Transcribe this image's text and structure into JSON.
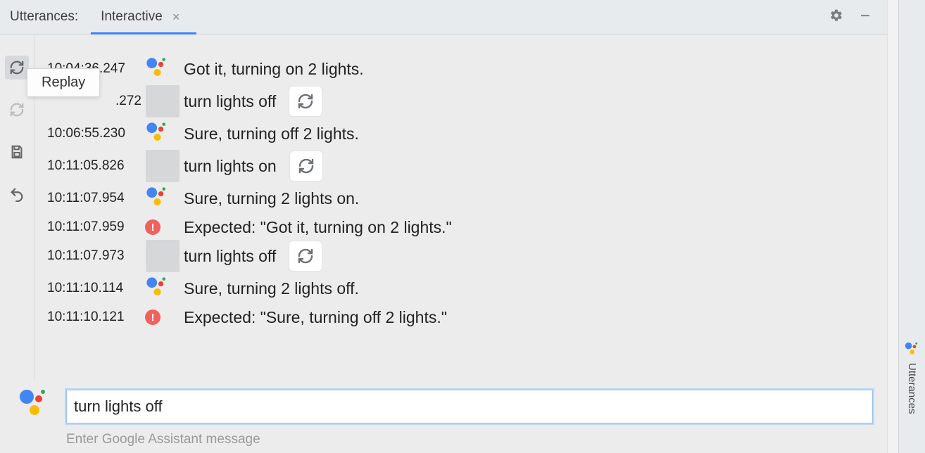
{
  "header": {
    "title_label": "Utterances:",
    "active_tab": "Interactive"
  },
  "tooltip": {
    "replay": "Replay"
  },
  "log": [
    {
      "ts": "10:04:36.247",
      "kind": "assistant",
      "text": "Got it, turning on 2 lights."
    },
    {
      "ts": ".272",
      "kind": "user",
      "text": "turn lights off",
      "replay": true,
      "partial_ts": true
    },
    {
      "ts": "10:06:55.230",
      "kind": "assistant",
      "text": "Sure, turning off 2 lights."
    },
    {
      "ts": "10:11:05.826",
      "kind": "user",
      "text": "turn lights on",
      "replay": true
    },
    {
      "ts": "10:11:07.954",
      "kind": "assistant",
      "text": "Sure, turning 2 lights on."
    },
    {
      "ts": "10:11:07.959",
      "kind": "error",
      "text": "Expected: \"Got it, turning on 2 lights.\""
    },
    {
      "ts": "10:11:07.973",
      "kind": "user",
      "text": "turn lights off",
      "replay": true
    },
    {
      "ts": "10:11:10.114",
      "kind": "assistant",
      "text": "Sure, turning 2 lights off."
    },
    {
      "ts": "10:11:10.121",
      "kind": "error",
      "text": "Expected: \"Sure, turning off 2 lights.\""
    }
  ],
  "input": {
    "value": "turn lights off",
    "hint": "Enter Google Assistant message"
  },
  "sidebar_right": {
    "label": "Utterances"
  }
}
